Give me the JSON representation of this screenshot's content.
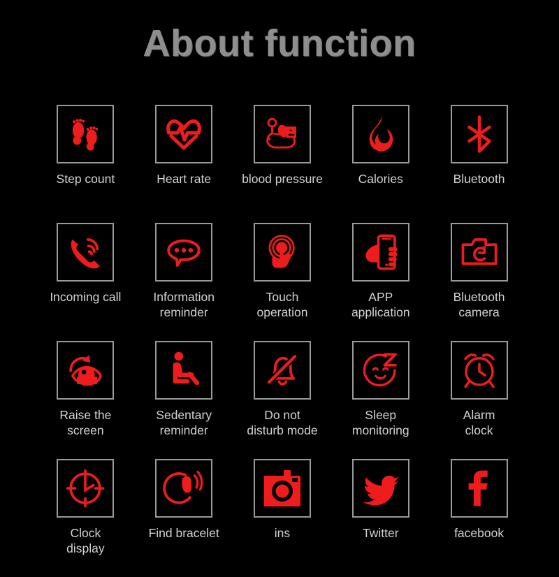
{
  "page": {
    "title": "About function",
    "background_color": "#000000",
    "accent_color": "#ee1c1c",
    "label_color": "#d2d2d2",
    "title_color": "#8e8e8e",
    "box_border_color": "#9a9a9a"
  },
  "grid": {
    "columns": 5,
    "rows": 4,
    "items": [
      {
        "icon": "footprints-icon",
        "label": "Step count"
      },
      {
        "icon": "heart-rate-icon",
        "label": "Heart rate"
      },
      {
        "icon": "blood-pressure-icon",
        "label": "blood pressure"
      },
      {
        "icon": "flame-icon",
        "label": "Calories"
      },
      {
        "icon": "bluetooth-icon",
        "label": "Bluetooth"
      },
      {
        "icon": "incoming-call-icon",
        "label": "Incoming call"
      },
      {
        "icon": "speech-bubble-icon",
        "label": "Information\nreminder"
      },
      {
        "icon": "touch-gesture-icon",
        "label": "Touch\noperation"
      },
      {
        "icon": "hand-phone-icon",
        "label": "APP\napplication"
      },
      {
        "icon": "camera-icon",
        "label": "Bluetooth\ncamera"
      },
      {
        "icon": "raise-wrist-eye-icon",
        "label": "Raise the\nscreen"
      },
      {
        "icon": "seated-person-icon",
        "label": "Sedentary\nreminder"
      },
      {
        "icon": "bell-muted-icon",
        "label": "Do not\ndisturb mode"
      },
      {
        "icon": "sleep-face-icon",
        "label": "Sleep\nmonitoring"
      },
      {
        "icon": "alarm-clock-icon",
        "label": "Alarm\nclock"
      },
      {
        "icon": "clock-face-icon",
        "label": "Clock\ndisplay"
      },
      {
        "icon": "bracelet-signal-icon",
        "label": "Find bracelet"
      },
      {
        "icon": "instagram-icon",
        "label": "ins"
      },
      {
        "icon": "twitter-bird-icon",
        "label": "Twitter"
      },
      {
        "icon": "facebook-icon",
        "label": "facebook"
      }
    ]
  }
}
